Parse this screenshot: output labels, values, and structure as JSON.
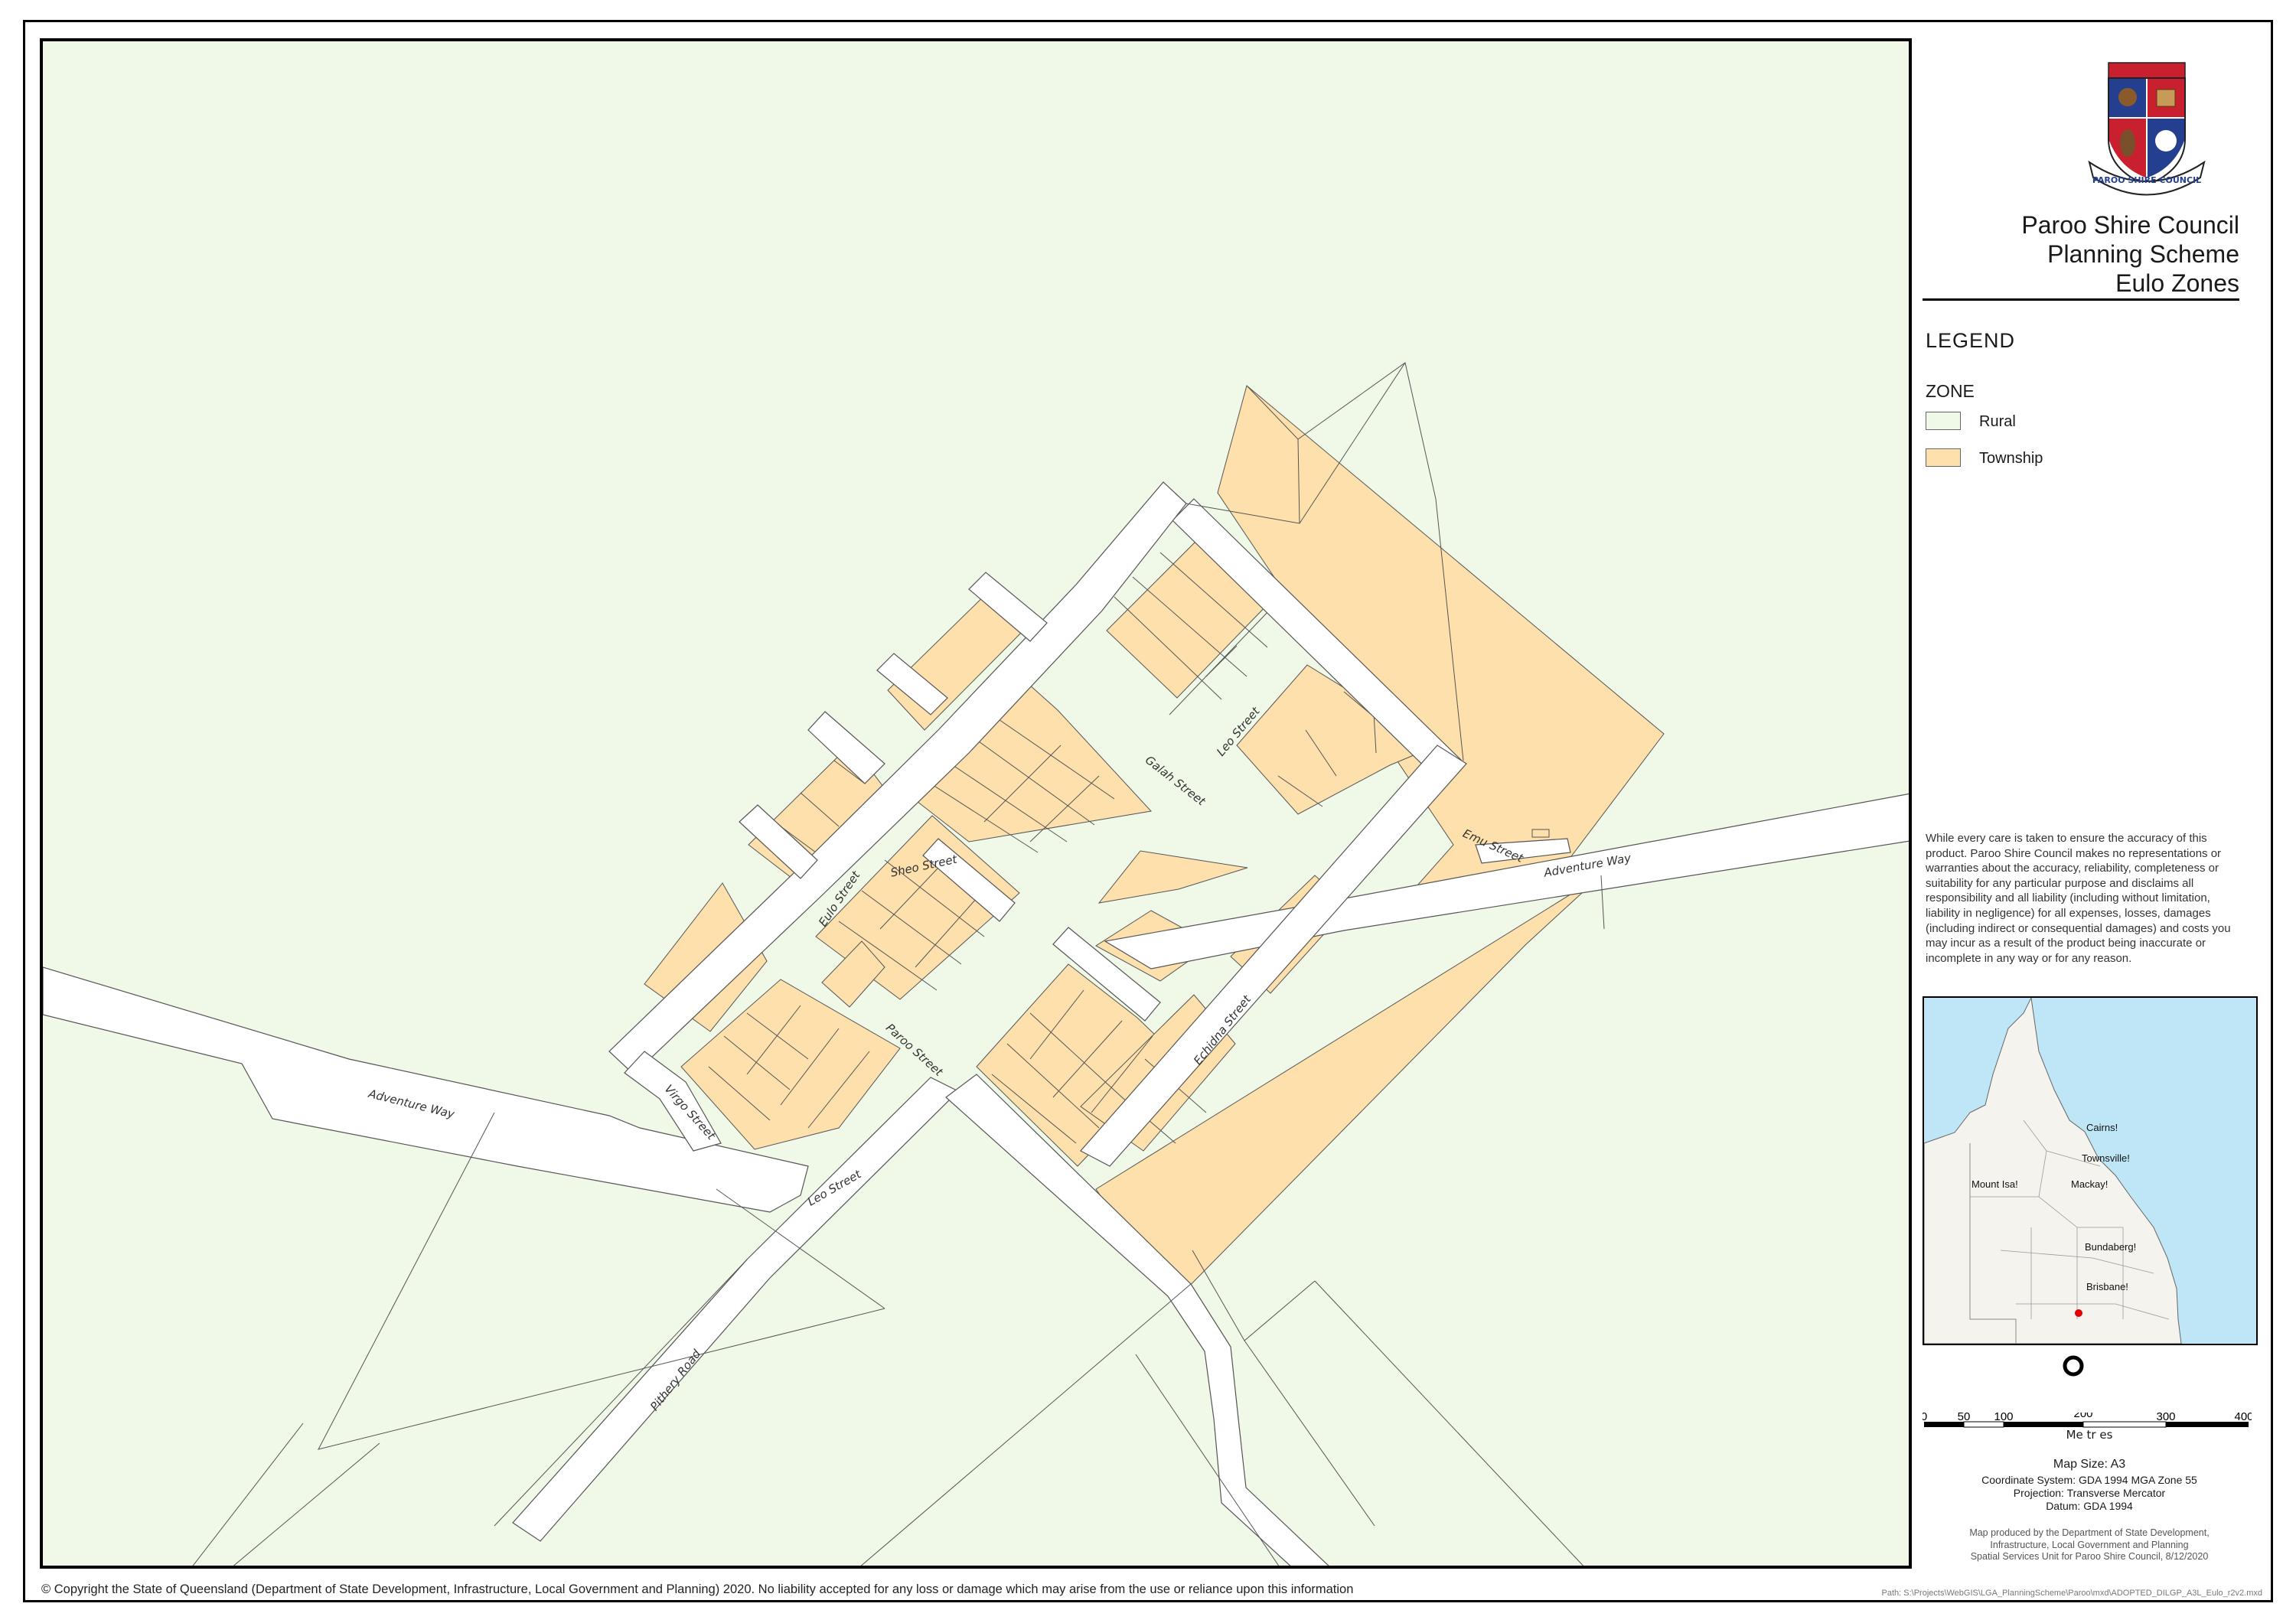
{
  "colors": {
    "rural": "#f0f8e8",
    "township": "#fde0ac",
    "road": "#ffffff",
    "water": "#bfe6f7",
    "land": "#f4f3ee",
    "location_marker": "#e60000",
    "logo_blue": "#243f8f",
    "logo_red": "#c8202e"
  },
  "panel": {
    "logo_text": "PAROO SHIRE COUNCIL",
    "title_lines": [
      "Paroo Shire Council",
      "Planning Scheme",
      "Eulo Zones"
    ],
    "legend_heading": "LEGEND",
    "zone_heading": "ZONE",
    "legend_items": [
      {
        "label": "Rural",
        "color": "#f0f8e8"
      },
      {
        "label": "Township",
        "color": "#fde0ac"
      }
    ],
    "disclaimer": "While every care is taken to ensure the accuracy of this product. Paroo Shire Council makes no representations or warranties about the accuracy, reliability, completeness or suitability for any particular purpose and disclaims all responsibility and all liability (including without limitation, liability in negligence) for all expenses, losses, damages (including indirect or consequential damages) and costs you may incur as a result of the product being inaccurate or incomplete in any way or for any reason.",
    "inset_labels": [
      "Cairns!",
      "Townsville!",
      "Mount Isa!",
      "Mackay!",
      "Bundaberg!",
      "Brisbane!"
    ],
    "scale_ticks": [
      "0",
      "50",
      "100",
      "200",
      "300",
      "400"
    ],
    "scale_unit": "Me tr es",
    "map_size": "Map Size:  A3",
    "coord_system": "Coordinate System: GDA 1994 MGA Zone 55",
    "projection": "Projection: Transverse Mercator",
    "datum": "Datum: GDA 1994",
    "producer_lines": [
      "Map produced by the Department of State Development,",
      "Infrastructure, Local Government and Planning",
      "Spatial Services Unit for Paroo Shire Council, 8/12/2020"
    ]
  },
  "map": {
    "street_labels": [
      "Galah Street",
      "Leo Street",
      "Emu Street",
      "Adventure Way",
      "Eulo Street",
      "Sheo Street",
      "Paroo Street",
      "Echidna Street",
      "Adventure Way",
      "Virgo Street",
      "Leo  Street",
      "Pithery Road"
    ]
  },
  "footer": {
    "copyright": "© Copyright the State of Queensland (Department of State Development, Infrastructure, Local Government and Planning) 2020. No liability accepted for any loss or damage which may arise from the use or reliance upon this information",
    "path": "Path: S:\\Projects\\WebGIS\\LGA_PlanningScheme\\Paroo\\mxd\\ADOPTED_DILGP_A3L_Eulo_r2v2.mxd"
  }
}
